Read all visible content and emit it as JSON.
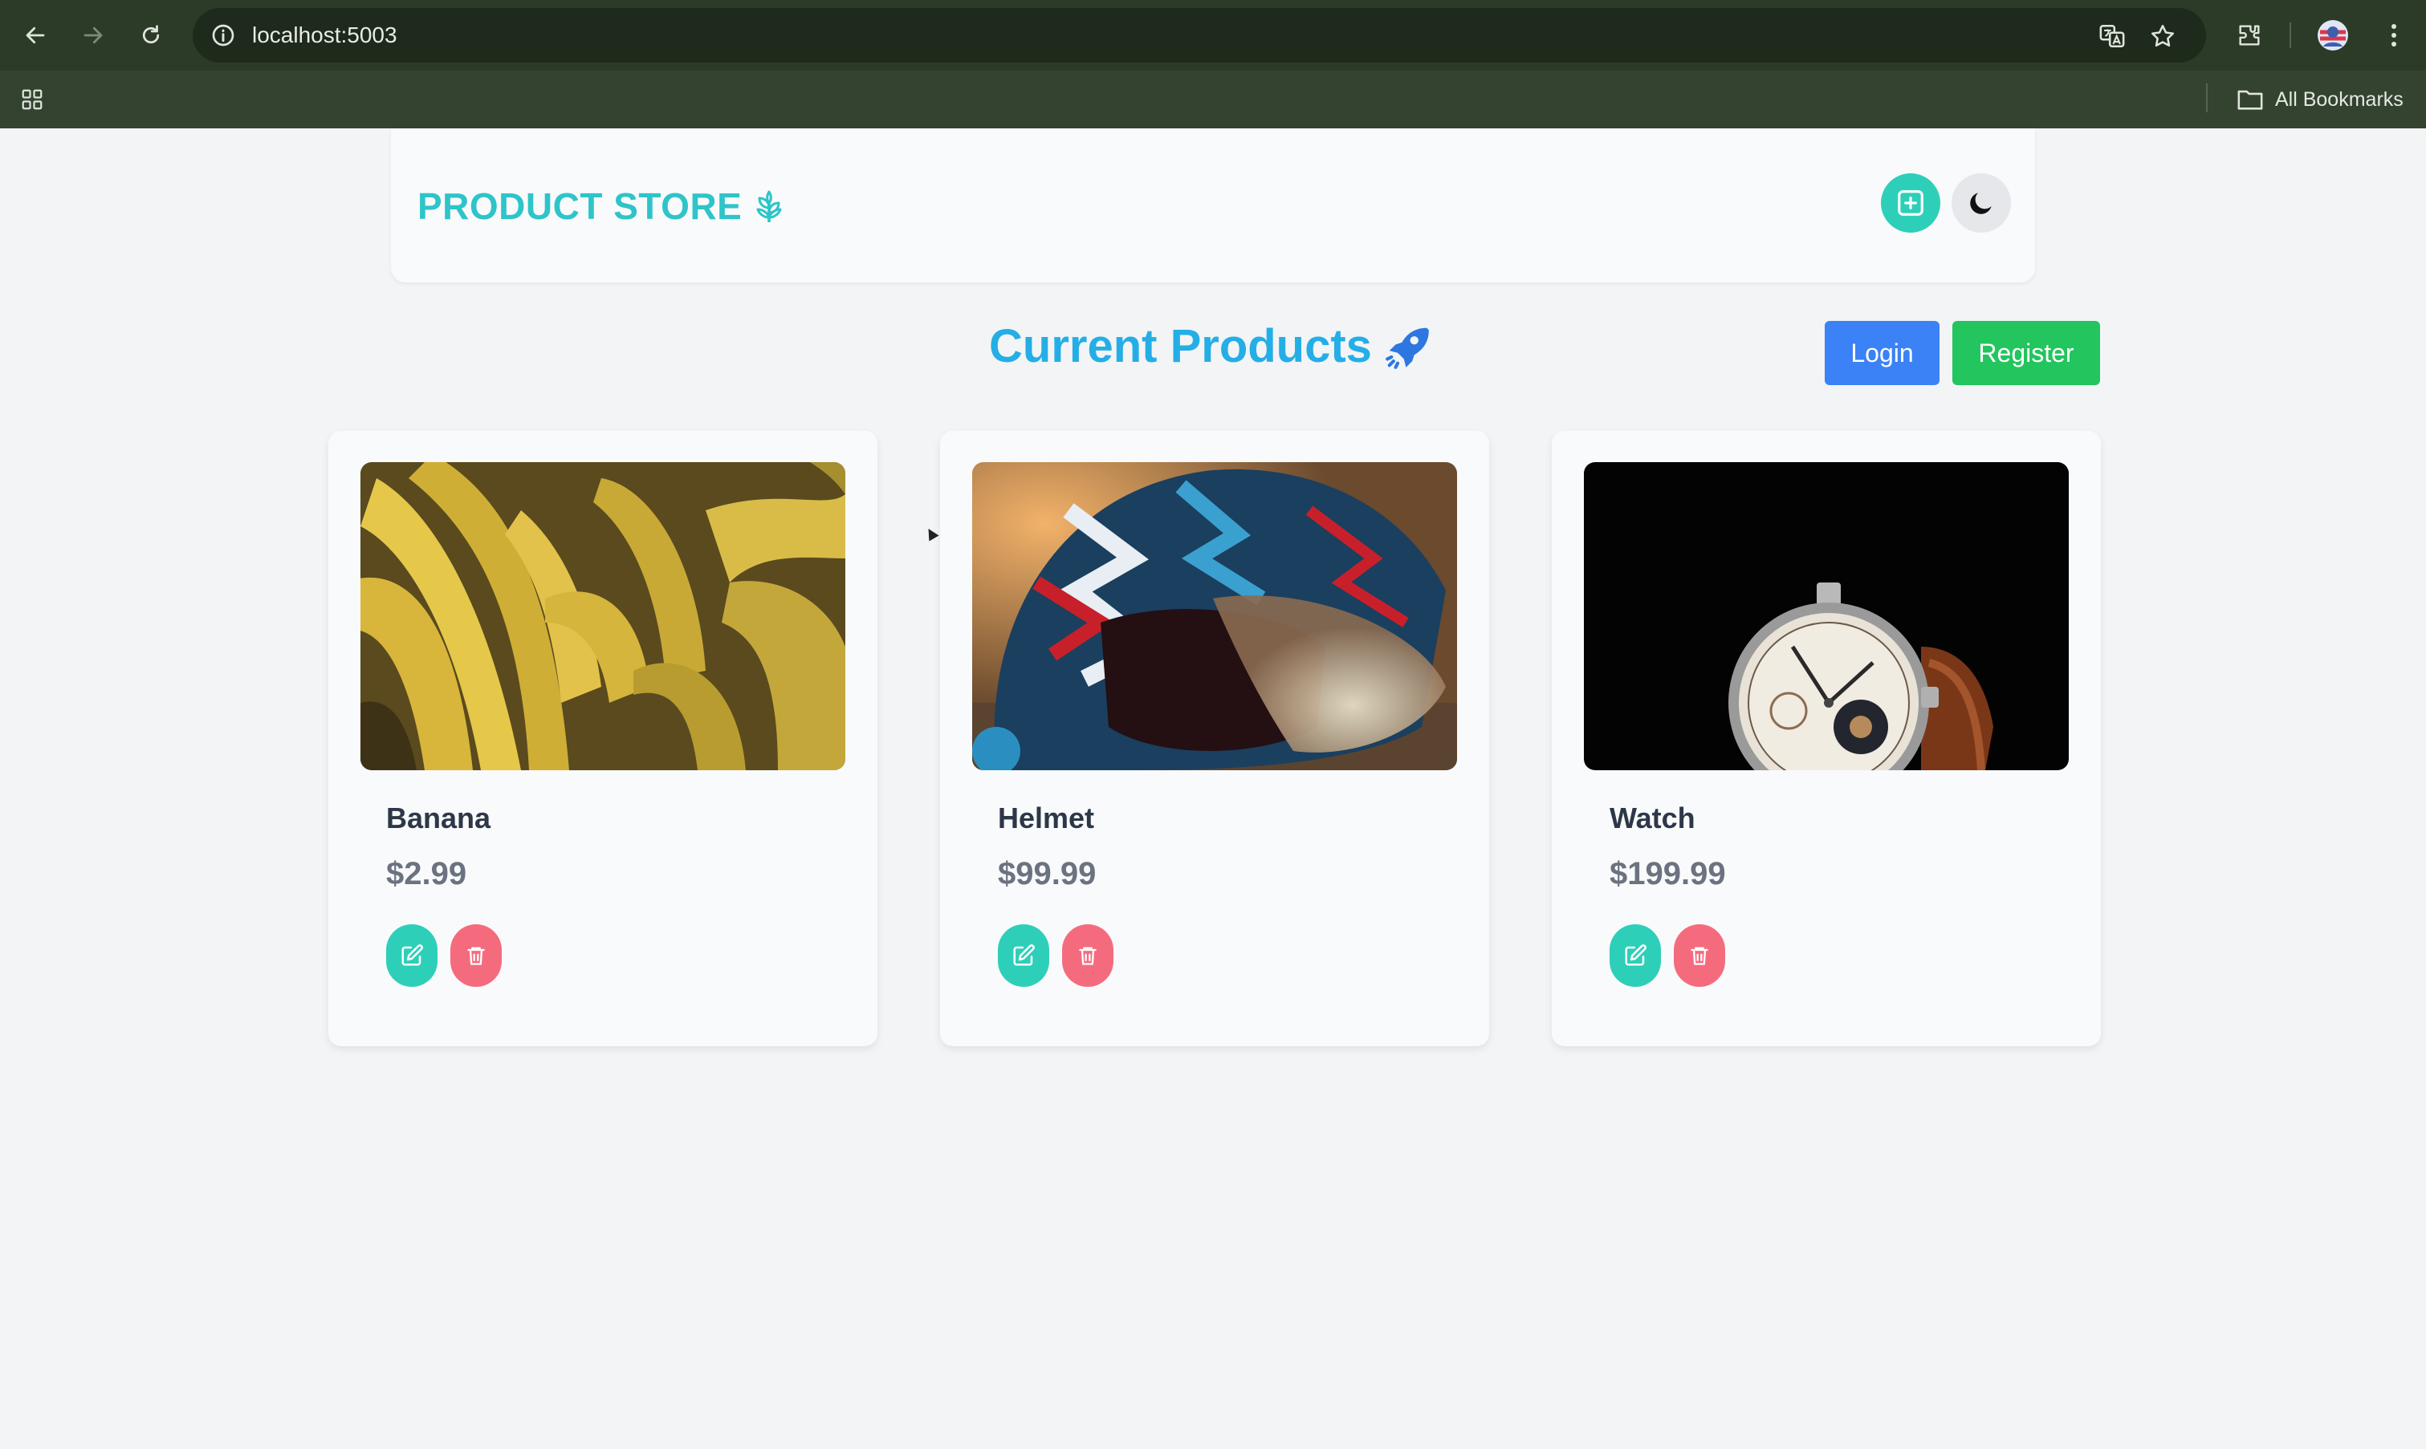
{
  "browser": {
    "url": "localhost:5003",
    "bookmarks_label": "All Bookmarks"
  },
  "header": {
    "brand": "PRODUCT STORE"
  },
  "main": {
    "title": "Current Products",
    "login_label": "Login",
    "register_label": "Register"
  },
  "products": [
    {
      "name": "Banana",
      "price": "$2.99"
    },
    {
      "name": "Helmet",
      "price": "$99.99"
    },
    {
      "name": "Watch",
      "price": "$199.99"
    }
  ],
  "colors": {
    "brand": "#2ec4c9",
    "title": "#25aee6",
    "login": "#3b82f6",
    "register": "#22c55e",
    "edit": "#2ecfb9",
    "delete": "#f56b7e"
  }
}
